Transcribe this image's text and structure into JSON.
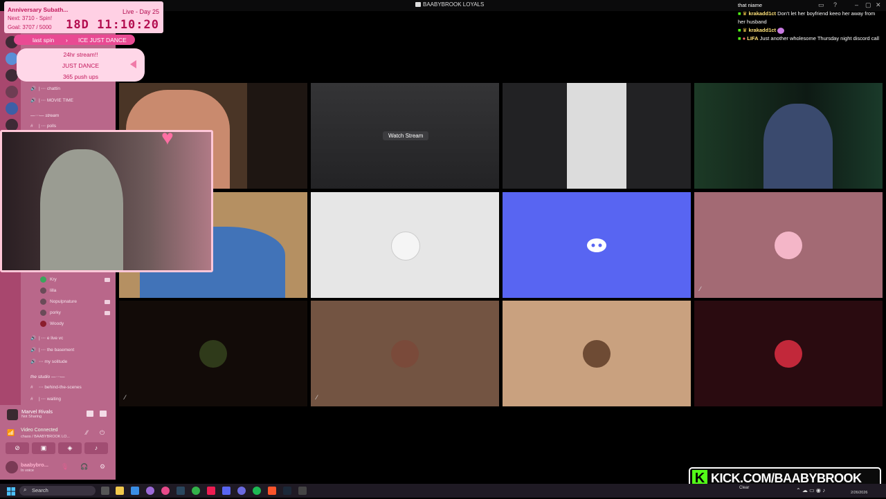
{
  "window": {
    "title": "BAABYBROOK LOYALS"
  },
  "overlay": {
    "title": "Anniversary Subath...",
    "next": "Next: 3710 - Spin!",
    "goal": "Goal: 3707 / 5000",
    "live": "Live - Day 25",
    "timer": "18D 11:10:20",
    "last_spin_label": "last spin",
    "last_spin_value": "ICE JUST DANCE",
    "wheel_items": [
      "24hr stream!!",
      "JUST DANCE",
      "365 push ups"
    ]
  },
  "sidebar": {
    "channels_top": [
      "chattin",
      "MOVIE TIME",
      "polls"
    ],
    "category_stream": "stream",
    "voice_users": [
      "Kry",
      "lilla",
      "Nopulpnature",
      "porky",
      "Woody"
    ],
    "channels_mid": [
      "e live vc",
      "the basement",
      "my solitude"
    ],
    "category_studio": "the studio",
    "channels_bottom": [
      "behind-the-scenes",
      "waiting"
    ]
  },
  "voice_panel": {
    "activity_title": "Marvel Rivals",
    "activity_sub": "Not Sharing",
    "status": "Video Connected",
    "status_sub": "chaos / BAABYBROOK LO...",
    "username": "baabybro...",
    "user_status": "In voice"
  },
  "tiles": {
    "watch_stream_label": "Watch Stream"
  },
  "chat": {
    "header": "that niame",
    "messages": [
      {
        "user": "krakadd1ct",
        "text": "Don't let her boyfriend keeo her away from her husband"
      },
      {
        "user": "krakadd1ct",
        "text": ""
      },
      {
        "user": "LIFA",
        "text": "Just another wholesome Thursday night discord call"
      }
    ]
  },
  "watermark": {
    "text": "KICK.COM/BAABYBROOK",
    "letter": "K"
  },
  "taskbar": {
    "search_placeholder": "Search",
    "weather": "Clear",
    "date": "2/26/2026"
  },
  "colors": {
    "sidebar": "#b9678a",
    "rail": "#a8476e",
    "overlay_bg": "#ffd0e4",
    "accent_pink": "#e94a93",
    "discord_blurple": "#5865f2",
    "kick_green": "#53fc18"
  }
}
